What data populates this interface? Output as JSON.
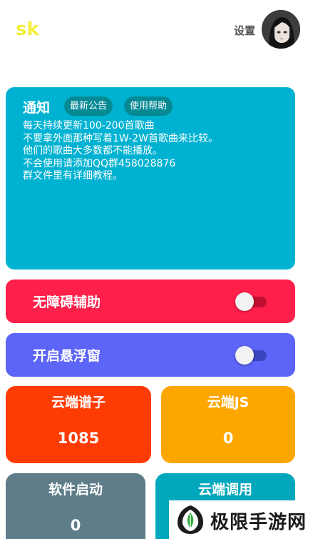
{
  "header": {
    "app_title": "sk",
    "settings_label": "设置"
  },
  "notice": {
    "title": "通知",
    "chips": {
      "latest": "最新公告",
      "help": "使用帮助"
    },
    "lines": [
      "每天持续更新100-200首歌曲",
      "不要拿外面那种写着1W-2W首歌曲来比较。",
      "他们的歌曲大多数都不能播放。",
      "不会使用请添加QQ群458028876",
      "群文件里有详细教程。"
    ]
  },
  "toggles": {
    "accessibility": {
      "label": "无障碍辅助",
      "enabled": false
    },
    "floating_window": {
      "label": "开启悬浮窗",
      "enabled": false
    }
  },
  "stats": {
    "cloud_sheets": {
      "label": "云端谱子",
      "value": "1085"
    },
    "cloud_js": {
      "label": "云端JS",
      "value": "0"
    },
    "app_launches": {
      "label": "软件启动",
      "value": "0"
    },
    "cloud_calls": {
      "label": "云端调用",
      "value": ""
    }
  },
  "watermark": {
    "text": "极限手游网",
    "logo": "leaf-shield-logo"
  },
  "colors": {
    "title_yellow": "#f5ee3a",
    "notice_cyan": "#00b2d2",
    "accessibility_red": "#fe1f4a",
    "floating_indigo": "#5c65f8",
    "sheets_orange": "#fe3b02",
    "js_amber": "#fca700",
    "launch_slate": "#5f7d89",
    "call_teal": "#00a7bd"
  },
  "icons": {
    "avatar": "anime-girl-avatar"
  }
}
